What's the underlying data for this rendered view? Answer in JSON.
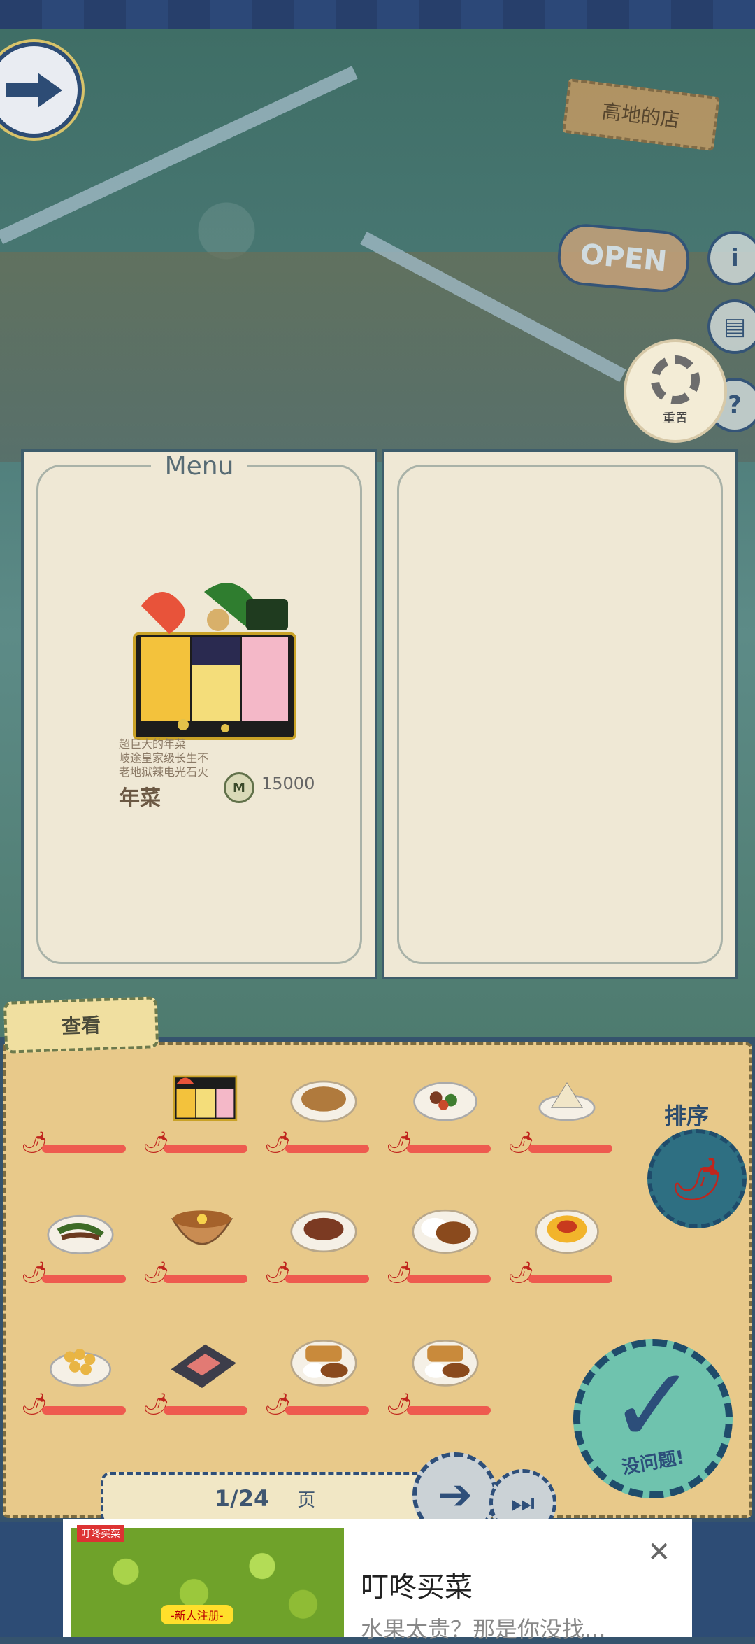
{
  "shop": {
    "sign_label": "高地的店",
    "open_label": "OPEN",
    "reset_label": "重置"
  },
  "menu": {
    "title": "Menu",
    "featured": {
      "name": "年菜",
      "desc_lines": [
        "超巨大的年菜",
        "岐途皇家级长生不",
        "老地狱辣电光石火"
      ],
      "currency_symbol": "M",
      "price": "15000"
    }
  },
  "panel": {
    "view_tab": "查看",
    "sort_label": "排序",
    "confirm_label": "没问题!",
    "page_indicator": "1/24",
    "page_unit": "页"
  },
  "dishes": [
    {
      "row": 0,
      "col": 0,
      "icon": "empty"
    },
    {
      "row": 0,
      "col": 1,
      "icon": "osechi-box"
    },
    {
      "row": 0,
      "col": 2,
      "icon": "noodles"
    },
    {
      "row": 0,
      "col": 3,
      "icon": "stir-fry"
    },
    {
      "row": 0,
      "col": 4,
      "icon": "sandwich"
    },
    {
      "row": 1,
      "col": 0,
      "icon": "pepper-steak"
    },
    {
      "row": 1,
      "col": 1,
      "icon": "ramen-bowl"
    },
    {
      "row": 1,
      "col": 2,
      "icon": "stew"
    },
    {
      "row": 1,
      "col": 3,
      "icon": "curry-rice"
    },
    {
      "row": 1,
      "col": 4,
      "icon": "omurice"
    },
    {
      "row": 2,
      "col": 0,
      "icon": "dango"
    },
    {
      "row": 2,
      "col": 1,
      "icon": "sashimi"
    },
    {
      "row": 2,
      "col": 2,
      "icon": "katsu-curry"
    },
    {
      "row": 2,
      "col": 3,
      "icon": "katsu-curry"
    }
  ],
  "ad": {
    "badge": "叮咚买菜",
    "promo": "-新人注册-",
    "title": "叮咚买菜",
    "desc": "水果太贵？那是你没找..."
  },
  "colors": {
    "spice": "#c0251d",
    "bar": "#ee5a4f",
    "accent": "#2e4f7a",
    "panel": "#e8c98a"
  }
}
